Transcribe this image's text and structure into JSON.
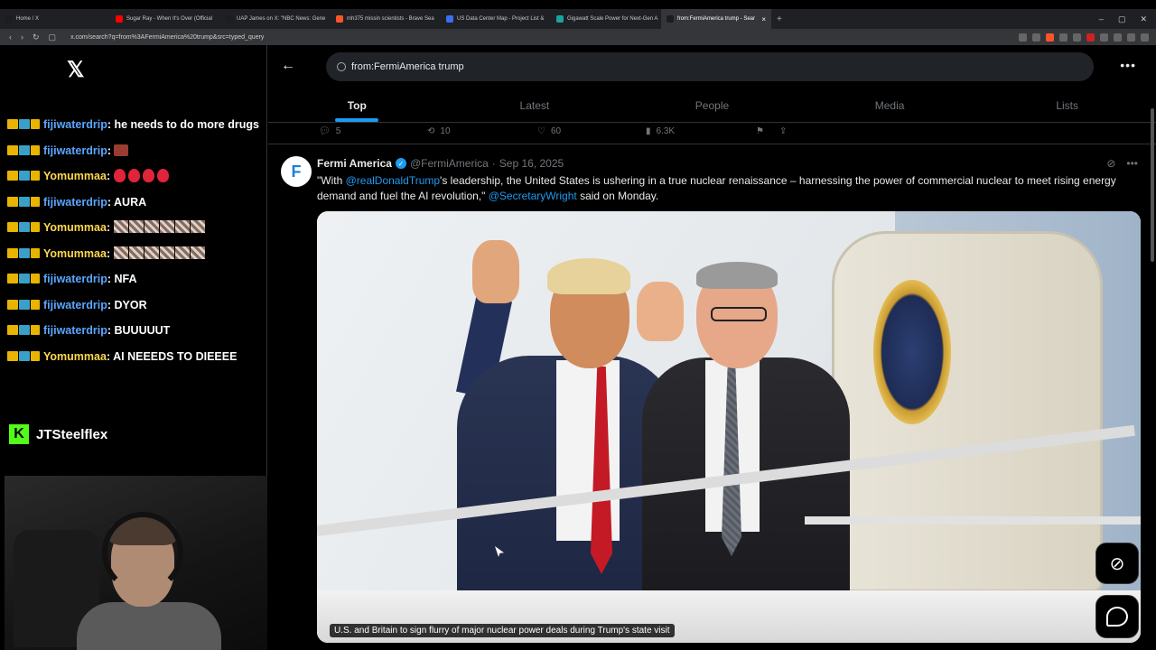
{
  "browser": {
    "tabs": [
      {
        "title": "Home / X",
        "color": "#1d1d1d"
      },
      {
        "title": "Sugar Ray - When It's Over (Official",
        "color": "#ff0000"
      },
      {
        "title": "UAP James on X: \"NBC News: Gene",
        "color": "#1d1d1d"
      },
      {
        "title": "mh375 missin scientists - Brave Sea",
        "color": "#fb542b"
      },
      {
        "title": "US Data Center Map - Project List &",
        "color": "#3b6ef5"
      },
      {
        "title": "Gigawatt Scale Power for Next-Gen A",
        "color": "#1aa3a3"
      },
      {
        "title": "from:FermiAmerica trump - Sear",
        "color": "#1d1d1d"
      }
    ],
    "new_tab": "+",
    "url": "x.com/search?q=from%3AFermiAmerica%20trump&src=typed_query"
  },
  "stream": {
    "chat": [
      {
        "user": "fijiwaterdrip",
        "text": "he needs to do more drugs",
        "user_color": "#5aa6ff",
        "tier": "2"
      },
      {
        "user": "fijiwaterdrip",
        "text": "",
        "emote": "square",
        "user_color": "#5aa6ff",
        "tier": "2"
      },
      {
        "user": "Yomummaa",
        "text": "",
        "emote": "drops",
        "user_color": "#ffd84d",
        "tier": "1"
      },
      {
        "user": "fijiwaterdrip",
        "text": "AURA",
        "user_color": "#5aa6ff",
        "tier": "2"
      },
      {
        "user": "Yomummaa",
        "text": "",
        "emote": "stacks",
        "user_color": "#ffd84d",
        "tier": "1"
      },
      {
        "user": "Yomummaa",
        "text": "",
        "emote": "stacks",
        "user_color": "#ffd84d",
        "tier": "1"
      },
      {
        "user": "fijiwaterdrip",
        "text": "NFA",
        "user_color": "#5aa6ff",
        "tier": "2"
      },
      {
        "user": "fijiwaterdrip",
        "text": "DYOR",
        "user_color": "#5aa6ff",
        "tier": "2"
      },
      {
        "user": "fijiwaterdrip",
        "text": "BUUUUUT",
        "user_color": "#5aa6ff",
        "tier": "2"
      },
      {
        "user": "Yomummaa",
        "text": "AI NEEEDS TO DIEEEE",
        "user_color": "#ffd84d",
        "tier": "1"
      }
    ],
    "streamer_name": "JTSteelflex"
  },
  "search": {
    "query": "from:FermiAmerica trump",
    "tabs": [
      "Top",
      "Latest",
      "People",
      "Media",
      "Lists"
    ],
    "active_tab": "Top"
  },
  "prev_tweet_actions": {
    "replies": "5",
    "reposts": "10",
    "likes": "60",
    "views": "6.3K"
  },
  "tweet": {
    "name": "Fermi America",
    "handle": "@FermiAmerica",
    "date": "Sep 16, 2025",
    "text_part1": "\"With ",
    "mention1": "@realDonaldTrump",
    "text_part2": "'s leadership, the United States is ushering in a true nuclear renaissance – harnessing the power of commercial nuclear to meet rising energy demand and fuel the AI revolution,\" ",
    "mention2": "@SecretaryWright",
    "text_part3": " said on Monday.",
    "media_caption": "U.S. and Britain to sign flurry of major nuclear power deals during Trump's state visit"
  },
  "colors": {
    "accent": "#1d9bf0",
    "kick": "#53fc18"
  }
}
